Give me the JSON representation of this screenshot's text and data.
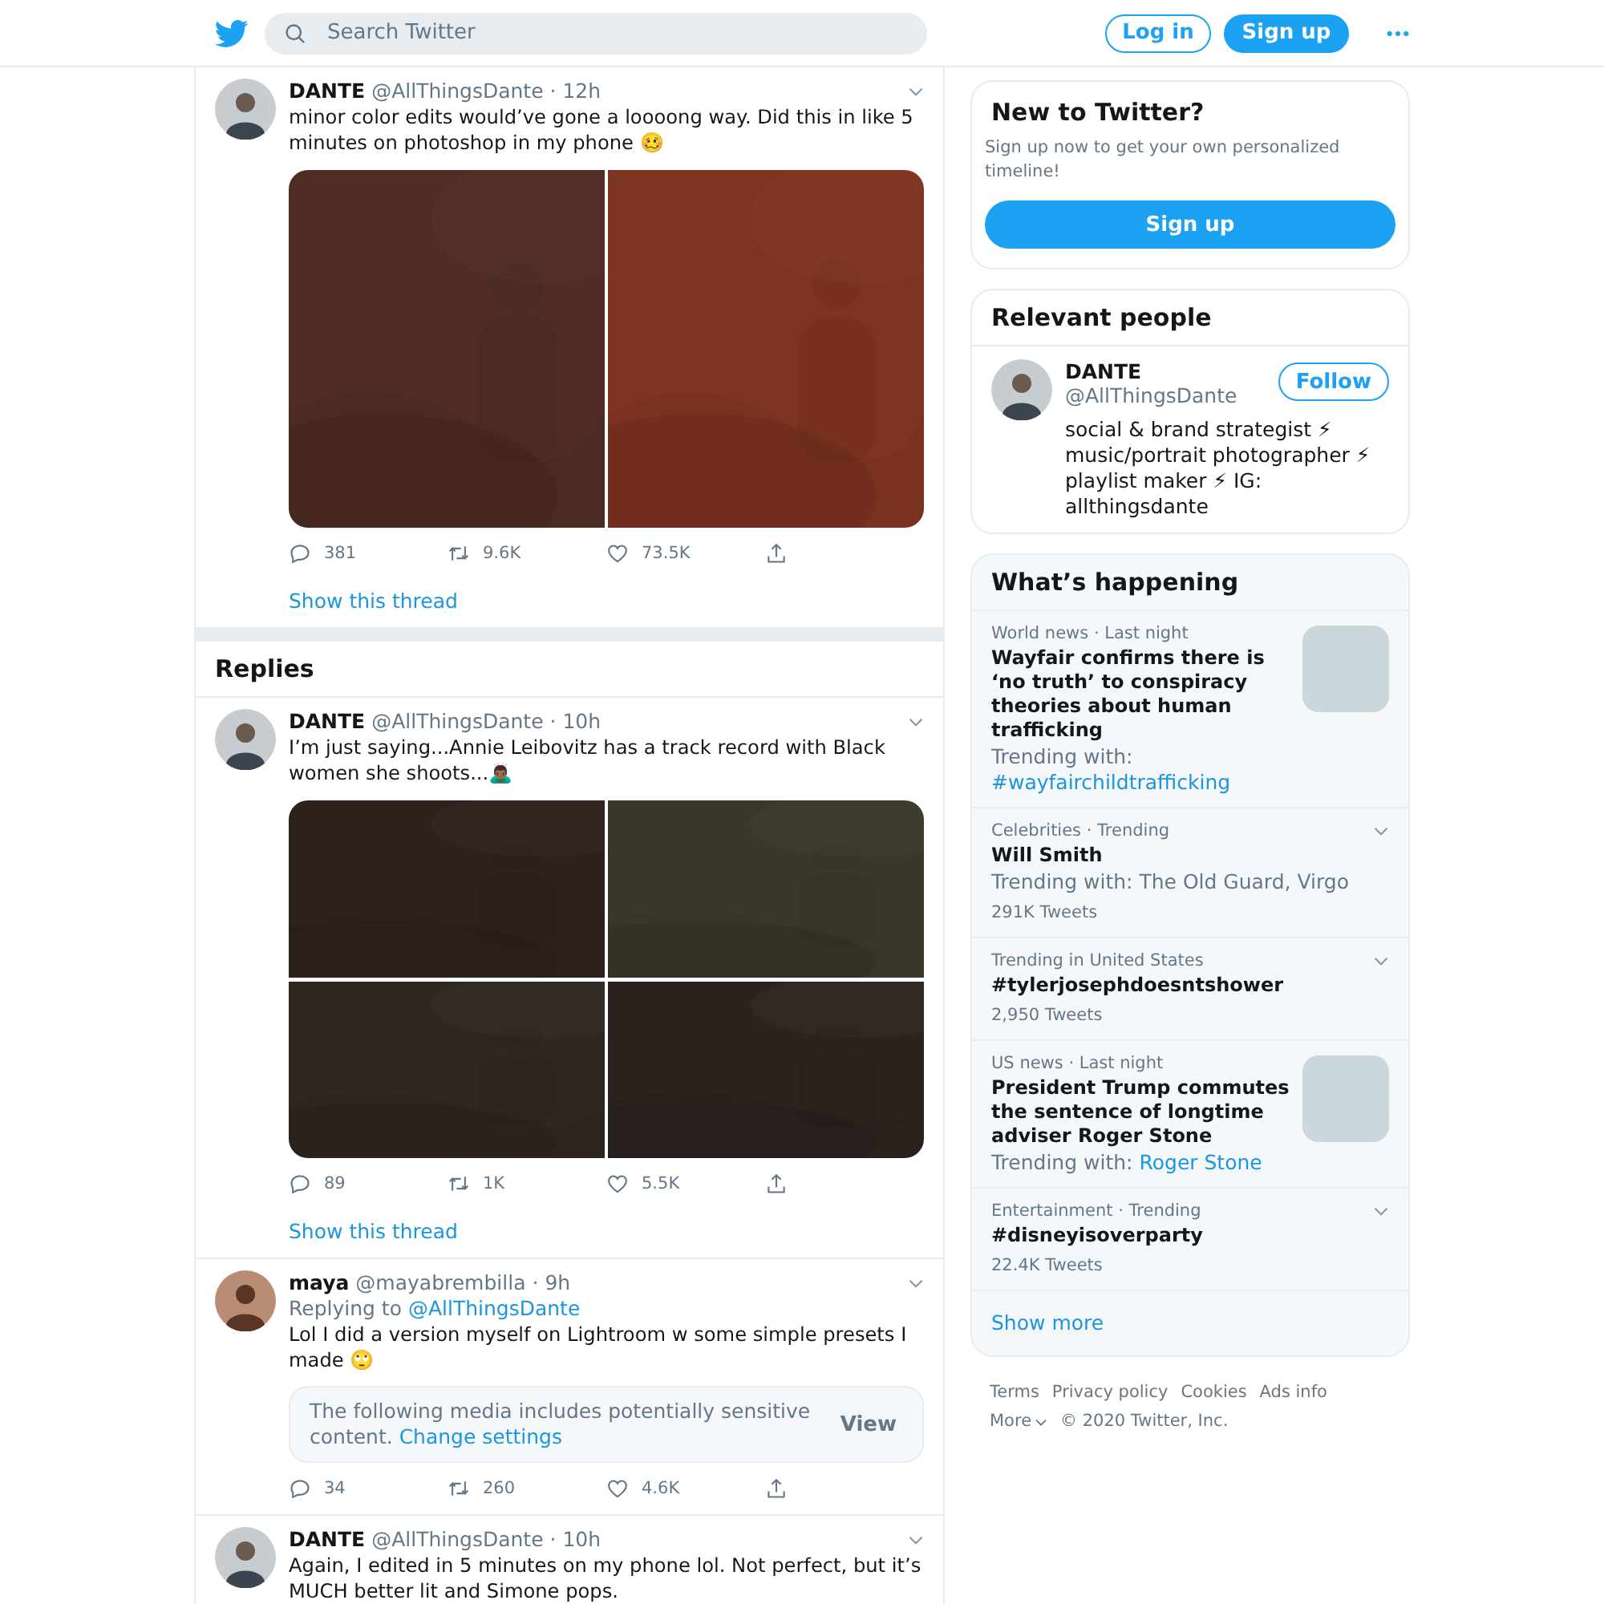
{
  "header": {
    "search": {
      "placeholder": "Search Twitter"
    },
    "login": "Log in",
    "signup": "Sign up"
  },
  "thread": [
    {
      "name": "DANTE",
      "handle": "@AllThingsDante",
      "time": "· 12h",
      "text": "minor color edits would’ve gone a loooong way. Did this in like 5 minutes on photoshop in my phone 🥴",
      "replies": "381",
      "retweets": "9.6K",
      "likes": "73.5K",
      "show_thread": "Show this thread"
    }
  ],
  "replies_heading": "Replies",
  "replies": [
    {
      "name": "DANTE",
      "handle": "@AllThingsDante",
      "time": "· 10h",
      "text": "I’m just saying...Annie Leibovitz has a track record with Black women she shoots...🙇🏾‍♂️",
      "replies": "89",
      "retweets": "1K",
      "likes": "5.5K",
      "show_thread": "Show this thread"
    },
    {
      "name": "maya",
      "handle": "@mayabrembilla",
      "time": "· 9h",
      "replying_label": "Replying to",
      "replying_to": "@AllThingsDante",
      "text": "Lol I did a version myself on Lightroom w some simple presets I made 🙄",
      "notice": {
        "text": "The following media includes potentially sensitive content.",
        "link": "Change settings",
        "button": "View"
      },
      "replies": "34",
      "retweets": "260",
      "likes": "4.6K"
    },
    {
      "name": "DANTE",
      "handle": "@AllThingsDante",
      "time": "· 10h",
      "text": "Again, I edited in 5 minutes on my phone lol. Not perfect, but it’s MUCH better lit and Simone pops."
    }
  ],
  "signup_card": {
    "title": "New to Twitter?",
    "text": "Sign up now to get your own personalized timeline!",
    "button": "Sign up"
  },
  "relevant_people": {
    "title": "Relevant people",
    "people": [
      {
        "name": "DANTE",
        "handle": "@AllThingsDante",
        "follow": "Follow",
        "bio": "social & brand strategist ⚡ music/portrait photographer ⚡ playlist maker ⚡ IG: allthingsdante"
      }
    ]
  },
  "whats_happening": {
    "title": "What’s happening",
    "trends": [
      {
        "kind": "news",
        "meta": "World news · Last night",
        "title": "Wayfair confirms there is ‘no truth’ to conspiracy theories about human trafficking",
        "context": "Trending with:",
        "context_link": "#wayfairchildtrafficking"
      },
      {
        "kind": "trend",
        "meta": "Celebrities · Trending",
        "title": "Will Smith",
        "context": "Trending with: The Old Guard, Virgo",
        "count": "291K Tweets"
      },
      {
        "kind": "trend",
        "meta": "Trending in United States",
        "title": "#tylerjosephdoesntshower",
        "count": "2,950 Tweets"
      },
      {
        "kind": "news",
        "meta": "US news · Last night",
        "title": "President Trump commutes the sentence of longtime adviser Roger Stone",
        "context": "Trending with:",
        "context_link": "Roger Stone"
      },
      {
        "kind": "trend",
        "meta": "Entertainment · Trending",
        "title": "#disneyisoverparty",
        "count": "22.4K Tweets"
      }
    ],
    "show_more": "Show more"
  },
  "footer": {
    "links": [
      "Terms",
      "Privacy policy",
      "Cookies",
      "Ads info"
    ],
    "more": "More",
    "copyright": "© 2020 Twitter, Inc."
  }
}
